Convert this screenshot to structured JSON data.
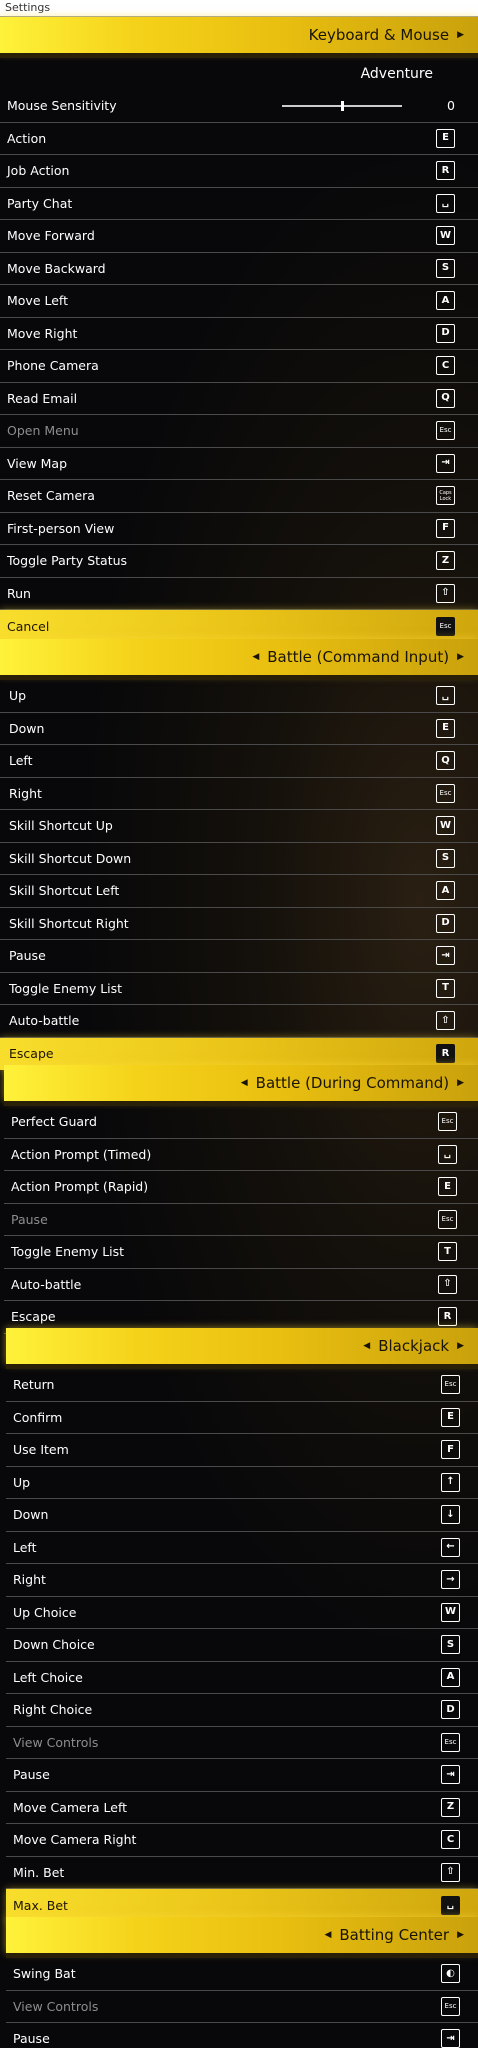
{
  "window": {
    "title": "Settings"
  },
  "sections": [
    {
      "header": "Keyboard & Mouse",
      "mode": "Adventure",
      "slider": {
        "label": "Mouse Sensitivity",
        "value": "0",
        "level": 0.5
      },
      "rows": [
        {
          "label": "Action",
          "key": "E"
        },
        {
          "label": "Job Action",
          "key": "R"
        },
        {
          "label": "Party Chat",
          "key": "␣",
          "icon": "space-key-icon"
        },
        {
          "label": "Move Forward",
          "key": "W"
        },
        {
          "label": "Move Backward",
          "key": "S"
        },
        {
          "label": "Move Left",
          "key": "A"
        },
        {
          "label": "Move Right",
          "key": "D"
        },
        {
          "label": "Phone Camera",
          "key": "C"
        },
        {
          "label": "Read Email",
          "key": "Q"
        },
        {
          "label": "Open Menu",
          "key": "Esc",
          "dim": true
        },
        {
          "label": "View Map",
          "key": "⇥",
          "icon": "tab-key-icon"
        },
        {
          "label": "Reset Camera",
          "key": "Caps Lock",
          "icon": "caps-lock-key-icon"
        },
        {
          "label": "First-person View",
          "key": "F"
        },
        {
          "label": "Toggle Party Status",
          "key": "Z"
        },
        {
          "label": "Run",
          "key": "⇧",
          "icon": "shift-key-icon"
        },
        {
          "label": "Cancel",
          "key": "Esc",
          "selected": true
        }
      ]
    },
    {
      "header": "Battle (Command Input)",
      "rows": [
        {
          "label": "Up",
          "key": "␣",
          "icon": "space-key-icon"
        },
        {
          "label": "Down",
          "key": "E"
        },
        {
          "label": "Left",
          "key": "Q"
        },
        {
          "label": "Right",
          "key": "Esc"
        },
        {
          "label": "Skill Shortcut Up",
          "key": "W"
        },
        {
          "label": "Skill Shortcut Down",
          "key": "S"
        },
        {
          "label": "Skill Shortcut Left",
          "key": "A"
        },
        {
          "label": "Skill Shortcut Right",
          "key": "D"
        },
        {
          "label": "Pause",
          "key": "⇥",
          "icon": "tab-key-icon"
        },
        {
          "label": "Toggle Enemy List",
          "key": "T"
        },
        {
          "label": "Auto-battle",
          "key": "⇧",
          "icon": "shift-key-icon"
        },
        {
          "label": "Escape",
          "key": "R",
          "selected": true
        }
      ]
    },
    {
      "header": "Battle (During Command)",
      "rows": [
        {
          "label": "Perfect Guard",
          "key": "Esc"
        },
        {
          "label": "Action Prompt (Timed)",
          "key": "␣",
          "icon": "space-key-icon"
        },
        {
          "label": "Action Prompt (Rapid)",
          "key": "E"
        },
        {
          "label": "Pause",
          "key": "Esc",
          "dim": true
        },
        {
          "label": "Toggle Enemy List",
          "key": "T"
        },
        {
          "label": "Auto-battle",
          "key": "⇧",
          "icon": "shift-key-icon"
        },
        {
          "label": "Escape",
          "key": "R"
        }
      ]
    },
    {
      "header": "Blackjack",
      "rows": [
        {
          "label": "Return",
          "key": "Esc"
        },
        {
          "label": "Confirm",
          "key": "E"
        },
        {
          "label": "Use Item",
          "key": "F"
        },
        {
          "label": "Up",
          "key": "↑",
          "icon": "arrow-up-key-icon"
        },
        {
          "label": "Down",
          "key": "↓",
          "icon": "arrow-down-key-icon"
        },
        {
          "label": "Left",
          "key": "←",
          "icon": "arrow-left-key-icon"
        },
        {
          "label": "Right",
          "key": "→",
          "icon": "arrow-right-key-icon"
        },
        {
          "label": "Up Choice",
          "key": "W"
        },
        {
          "label": "Down Choice",
          "key": "S"
        },
        {
          "label": "Left Choice",
          "key": "A"
        },
        {
          "label": "Right Choice",
          "key": "D"
        },
        {
          "label": "View Controls",
          "key": "Esc",
          "dim": true
        },
        {
          "label": "Pause",
          "key": "⇥",
          "icon": "tab-key-icon"
        },
        {
          "label": "Move Camera Left",
          "key": "Z"
        },
        {
          "label": "Move Camera Right",
          "key": "C"
        },
        {
          "label": "Min. Bet",
          "key": "⇧",
          "icon": "shift-key-icon"
        },
        {
          "label": "Max. Bet",
          "key": "␣",
          "icon": "space-key-icon",
          "selected": true
        }
      ]
    },
    {
      "header": "Batting Center",
      "rows": [
        {
          "label": "Swing Bat",
          "key": "◐",
          "icon": "mouse-left-button-icon"
        },
        {
          "label": "View Controls",
          "key": "Esc",
          "dim": true
        },
        {
          "label": "Pause",
          "key": "⇥",
          "icon": "tab-key-icon"
        }
      ]
    }
  ]
}
